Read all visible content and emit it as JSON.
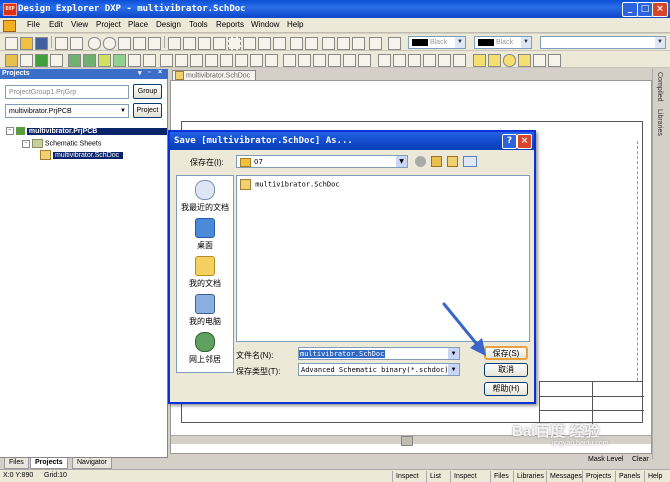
{
  "app": {
    "title": "Design Explorer DXP - multivibrator.SchDoc",
    "icon_text": "DXP"
  },
  "window_buttons": [
    "_",
    "□",
    "×"
  ],
  "menu": [
    "File",
    "Edit",
    "View",
    "Project",
    "Place",
    "Design",
    "Tools",
    "Reports",
    "Window",
    "Help"
  ],
  "toolbar": {
    "color1": "Black",
    "color2": "Black"
  },
  "projects_panel": {
    "title": "Projects",
    "group_field": "ProjectGroup1.PrjGrp",
    "group_button": "Group",
    "project_field": "multivibrator.PrjPCB",
    "project_button": "Project",
    "tree": [
      {
        "label": "multivibrator.PrjPCB",
        "level": 0,
        "selected": true
      },
      {
        "label": "Schematic Sheets",
        "level": 1,
        "selected": false
      },
      {
        "label": "multivibrator.SchDoc",
        "level": 2,
        "selected": true
      }
    ],
    "tabs": [
      "Files",
      "Projects",
      "Navigator"
    ]
  },
  "document": {
    "tab_label": "multivibrator.SchDoc"
  },
  "right_panel_tabs": [
    "Compiled",
    "Libraries"
  ],
  "dialog": {
    "title": "Save [multivibrator.SchDoc] As...",
    "save_in_label": "保存在(I):",
    "save_in_value": "07",
    "places": [
      "我最近的文档",
      "桌面",
      "我的文档",
      "我的电脑",
      "网上邻居"
    ],
    "files": [
      "multivibrator.SchDoc"
    ],
    "filename_label": "文件名(N):",
    "filename_value": "multivibrator.SchDoc",
    "filetype_label": "保存类型(T):",
    "filetype_value": "Advanced Schematic binary(*.schdoc)",
    "save_button": "保存(S)",
    "cancel_button": "取消",
    "help_button": "帮助(H)"
  },
  "status": {
    "coords": "X:0 Y:890",
    "grid": "Grid:10",
    "right_buttons": [
      "Inspect",
      "List",
      "Inspect",
      "Files",
      "Libraries",
      "Messages",
      "Projects",
      "Panels",
      "Help"
    ],
    "mask_level": "Mask Level",
    "clear": "Clear"
  },
  "watermark": "Bai百度 经验",
  "watermark_url": "jingyan.baidu.com",
  "colors": {
    "titlebar": "#0a4ed6",
    "selection": "#0a246a",
    "annotation_arrow": "#3a66c8"
  }
}
